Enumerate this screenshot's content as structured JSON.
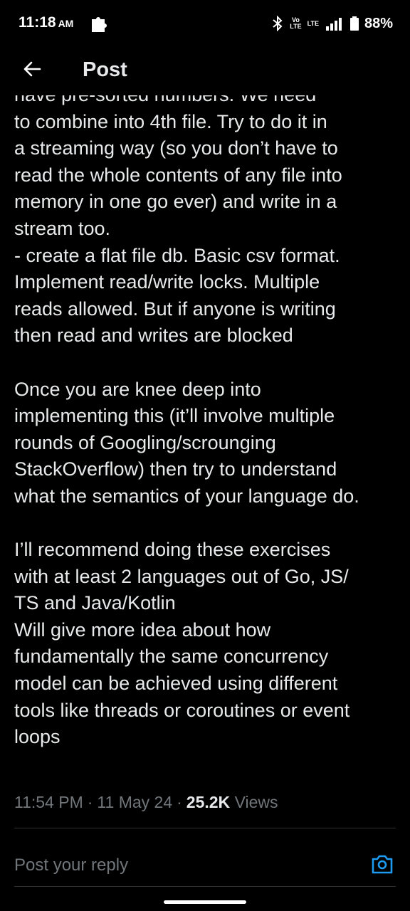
{
  "status_bar": {
    "time": "11:18",
    "ampm": "AM",
    "network_top": "Vo",
    "network_bottom": "LTE",
    "network_type": "LTE",
    "battery": "88%"
  },
  "header": {
    "title": "Post"
  },
  "post": {
    "text": "have pre-sorted numbers. We need\nto combine into 4th file. Try to do it in\na streaming way (so you don’t have to\nread the whole contents of any file into\nmemory in one go ever) and write in a\nstream too.\n- create a flat file db. Basic csv format.\nImplement read/write locks. Multiple\nreads allowed. But if anyone is writing\nthen read and writes are blocked\n\nOnce you are knee deep into\nimplementing this (it’ll involve multiple\nrounds of Googling/scrounging\nStackOverflow) then try to understand\nwhat the semantics of your language do.\n\nI’ll recommend doing these exercises\nwith at least 2 languages out of Go, JS/\nTS and Java/Kotlin\nWill give more idea about how\nfundamentally the same concurrency\nmodel can be achieved using different\ntools like threads or coroutines or event\nloops",
    "time": "11:54 PM",
    "date": "11 May 24",
    "views_count": "25.2K",
    "views_label": "Views"
  },
  "reply": {
    "placeholder": "Post your reply"
  },
  "icons": {
    "back": "arrow-left-icon",
    "camera": "camera-icon",
    "puzzle": "puzzle-icon",
    "bluetooth": "bluetooth-icon",
    "signal": "signal-icon",
    "battery": "battery-icon"
  },
  "colors": {
    "background": "#000000",
    "text": "#e7e9ea",
    "muted": "#71767b",
    "accent": "#1d9bf0",
    "divider": "#2f3336"
  }
}
